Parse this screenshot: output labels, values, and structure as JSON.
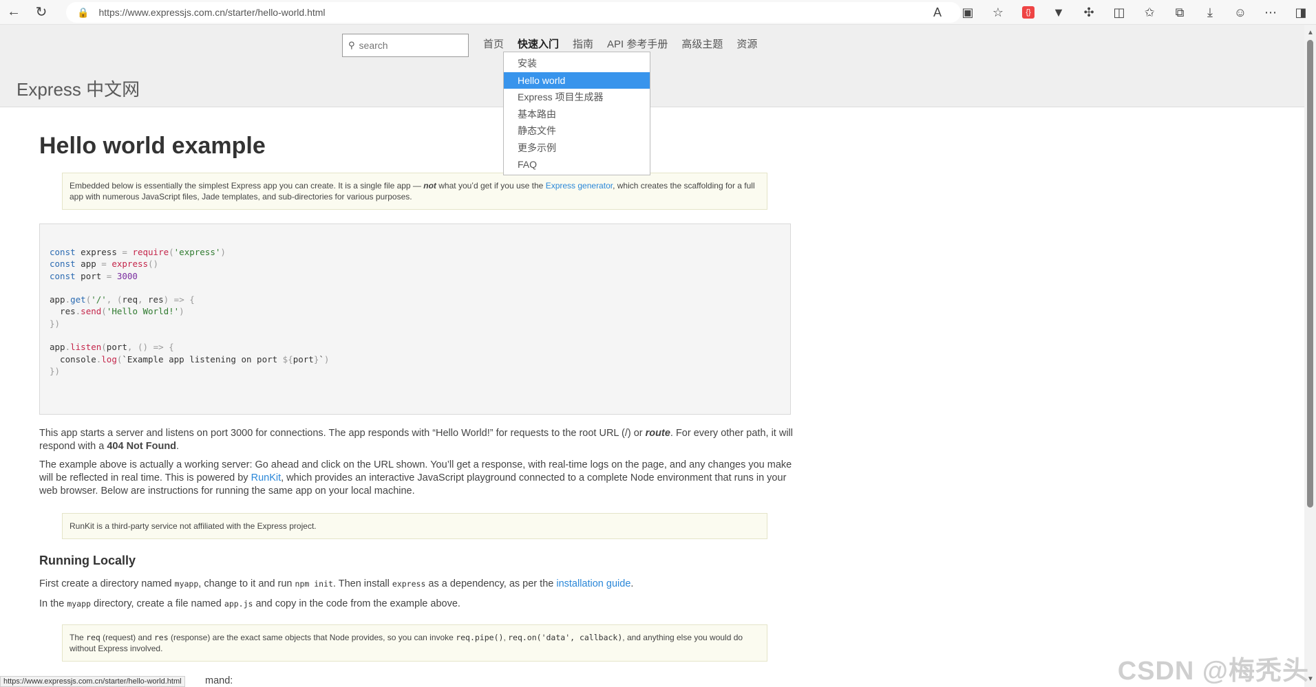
{
  "browser": {
    "url": "https://www.expressjs.com.cn/starter/hello-world.html",
    "ext_badge": "{}"
  },
  "site": {
    "logo": "Express 中文网",
    "search_placeholder": "search",
    "nav": [
      "首页",
      "快速入门",
      "指南",
      "API 参考手册",
      "高级主题",
      "资源"
    ],
    "dropdown": [
      "安装",
      "Hello world",
      "Express 项目生成器",
      "基本路由",
      "静态文件",
      "更多示例",
      "FAQ"
    ]
  },
  "page": {
    "title": "Hello world example",
    "note1": {
      "pre": "Embedded below is essentially the simplest Express app you can create. It is a single file app — ",
      "em": "not",
      "mid": " what you’d get if you use the ",
      "link": "Express generator",
      "post": ", which creates the scaffolding for a full app with numerous JavaScript files, Jade templates, and sub-directories for various purposes."
    },
    "code_lines": [
      "const express = require('express')",
      "const app = express()",
      "const port = 3000",
      "",
      "app.get('/', (req, res) => {",
      "  res.send('Hello World!')",
      "})",
      "",
      "app.listen(port, () => {",
      "  console.log(`Example app listening on port ${port}`)",
      "})"
    ],
    "para1": {
      "pre": "This app starts a server and listens on port 3000 for connections. The app responds with “Hello World!” for requests to the root URL (/) or ",
      "em": "route",
      "mid": ". For every other path, it will respond with a ",
      "strong": "404 Not Found",
      "post": "."
    },
    "para2": {
      "pre": "The example above is actually a working server: Go ahead and click on the URL shown. You’ll get a response, with real-time logs on the page, and any changes you make will be reflected in real time. This is powered by ",
      "link": "RunKit",
      "post": ", which provides an interactive JavaScript playground connected to a complete Node environment that runs in your web browser. Below are instructions for running the same app on your local machine."
    },
    "note2": "RunKit is a third-party service not affiliated with the Express project.",
    "section_title": "Running Locally",
    "para3": {
      "a": "First create a directory named ",
      "code1": "myapp",
      "b": ", change to it and run ",
      "code2": "npm init",
      "c": ". Then install ",
      "code3": "express",
      "d": " as a dependency, as per the ",
      "link": "installation guide",
      "e": "."
    },
    "para4": {
      "a": "In the ",
      "code1": "myapp",
      "b": " directory, create a file named ",
      "code2": "app.js",
      "c": " and copy in the code from the example above."
    },
    "note3": {
      "a": "The ",
      "code1": "req",
      "b": " (request) and ",
      "code2": "res",
      "c": " (response) are the exact same objects that Node provides, so you can invoke ",
      "code3": "req.pipe()",
      "d": ", ",
      "code4": "req.on('data', callback)",
      "e": ", and anything else you would do without Express involved."
    },
    "tail_text": "mand:"
  },
  "status_url": "https://www.expressjs.com.cn/starter/hello-world.html",
  "watermark": "CSDN @梅秃头"
}
